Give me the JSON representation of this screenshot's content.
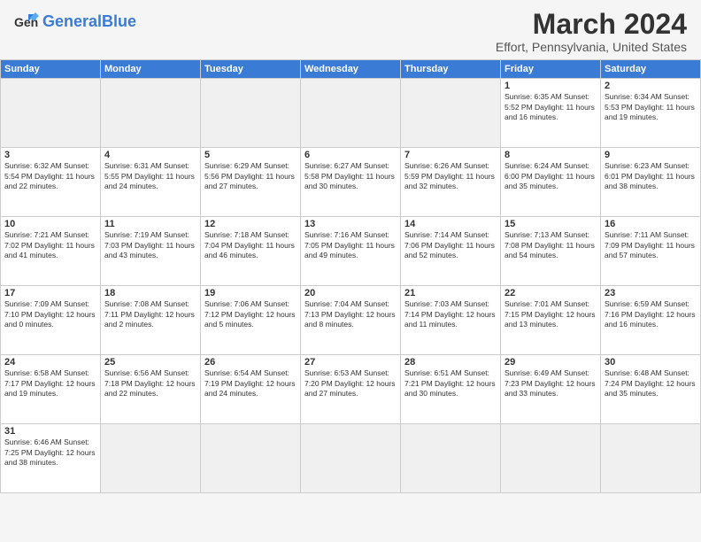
{
  "header": {
    "logo_general": "General",
    "logo_blue": "Blue",
    "month_year": "March 2024",
    "location": "Effort, Pennsylvania, United States"
  },
  "weekdays": [
    "Sunday",
    "Monday",
    "Tuesday",
    "Wednesday",
    "Thursday",
    "Friday",
    "Saturday"
  ],
  "weeks": [
    [
      {
        "day": "",
        "info": "",
        "empty": true
      },
      {
        "day": "",
        "info": "",
        "empty": true
      },
      {
        "day": "",
        "info": "",
        "empty": true
      },
      {
        "day": "",
        "info": "",
        "empty": true
      },
      {
        "day": "",
        "info": "",
        "empty": true
      },
      {
        "day": "1",
        "info": "Sunrise: 6:35 AM\nSunset: 5:52 PM\nDaylight: 11 hours\nand 16 minutes."
      },
      {
        "day": "2",
        "info": "Sunrise: 6:34 AM\nSunset: 5:53 PM\nDaylight: 11 hours\nand 19 minutes."
      }
    ],
    [
      {
        "day": "3",
        "info": "Sunrise: 6:32 AM\nSunset: 5:54 PM\nDaylight: 11 hours\nand 22 minutes."
      },
      {
        "day": "4",
        "info": "Sunrise: 6:31 AM\nSunset: 5:55 PM\nDaylight: 11 hours\nand 24 minutes."
      },
      {
        "day": "5",
        "info": "Sunrise: 6:29 AM\nSunset: 5:56 PM\nDaylight: 11 hours\nand 27 minutes."
      },
      {
        "day": "6",
        "info": "Sunrise: 6:27 AM\nSunset: 5:58 PM\nDaylight: 11 hours\nand 30 minutes."
      },
      {
        "day": "7",
        "info": "Sunrise: 6:26 AM\nSunset: 5:59 PM\nDaylight: 11 hours\nand 32 minutes."
      },
      {
        "day": "8",
        "info": "Sunrise: 6:24 AM\nSunset: 6:00 PM\nDaylight: 11 hours\nand 35 minutes."
      },
      {
        "day": "9",
        "info": "Sunrise: 6:23 AM\nSunset: 6:01 PM\nDaylight: 11 hours\nand 38 minutes."
      }
    ],
    [
      {
        "day": "10",
        "info": "Sunrise: 7:21 AM\nSunset: 7:02 PM\nDaylight: 11 hours\nand 41 minutes."
      },
      {
        "day": "11",
        "info": "Sunrise: 7:19 AM\nSunset: 7:03 PM\nDaylight: 11 hours\nand 43 minutes."
      },
      {
        "day": "12",
        "info": "Sunrise: 7:18 AM\nSunset: 7:04 PM\nDaylight: 11 hours\nand 46 minutes."
      },
      {
        "day": "13",
        "info": "Sunrise: 7:16 AM\nSunset: 7:05 PM\nDaylight: 11 hours\nand 49 minutes."
      },
      {
        "day": "14",
        "info": "Sunrise: 7:14 AM\nSunset: 7:06 PM\nDaylight: 11 hours\nand 52 minutes."
      },
      {
        "day": "15",
        "info": "Sunrise: 7:13 AM\nSunset: 7:08 PM\nDaylight: 11 hours\nand 54 minutes."
      },
      {
        "day": "16",
        "info": "Sunrise: 7:11 AM\nSunset: 7:09 PM\nDaylight: 11 hours\nand 57 minutes."
      }
    ],
    [
      {
        "day": "17",
        "info": "Sunrise: 7:09 AM\nSunset: 7:10 PM\nDaylight: 12 hours\nand 0 minutes."
      },
      {
        "day": "18",
        "info": "Sunrise: 7:08 AM\nSunset: 7:11 PM\nDaylight: 12 hours\nand 2 minutes."
      },
      {
        "day": "19",
        "info": "Sunrise: 7:06 AM\nSunset: 7:12 PM\nDaylight: 12 hours\nand 5 minutes."
      },
      {
        "day": "20",
        "info": "Sunrise: 7:04 AM\nSunset: 7:13 PM\nDaylight: 12 hours\nand 8 minutes."
      },
      {
        "day": "21",
        "info": "Sunrise: 7:03 AM\nSunset: 7:14 PM\nDaylight: 12 hours\nand 11 minutes."
      },
      {
        "day": "22",
        "info": "Sunrise: 7:01 AM\nSunset: 7:15 PM\nDaylight: 12 hours\nand 13 minutes."
      },
      {
        "day": "23",
        "info": "Sunrise: 6:59 AM\nSunset: 7:16 PM\nDaylight: 12 hours\nand 16 minutes."
      }
    ],
    [
      {
        "day": "24",
        "info": "Sunrise: 6:58 AM\nSunset: 7:17 PM\nDaylight: 12 hours\nand 19 minutes."
      },
      {
        "day": "25",
        "info": "Sunrise: 6:56 AM\nSunset: 7:18 PM\nDaylight: 12 hours\nand 22 minutes."
      },
      {
        "day": "26",
        "info": "Sunrise: 6:54 AM\nSunset: 7:19 PM\nDaylight: 12 hours\nand 24 minutes."
      },
      {
        "day": "27",
        "info": "Sunrise: 6:53 AM\nSunset: 7:20 PM\nDaylight: 12 hours\nand 27 minutes."
      },
      {
        "day": "28",
        "info": "Sunrise: 6:51 AM\nSunset: 7:21 PM\nDaylight: 12 hours\nand 30 minutes."
      },
      {
        "day": "29",
        "info": "Sunrise: 6:49 AM\nSunset: 7:23 PM\nDaylight: 12 hours\nand 33 minutes."
      },
      {
        "day": "30",
        "info": "Sunrise: 6:48 AM\nSunset: 7:24 PM\nDaylight: 12 hours\nand 35 minutes."
      }
    ],
    [
      {
        "day": "31",
        "info": "Sunrise: 6:46 AM\nSunset: 7:25 PM\nDaylight: 12 hours\nand 38 minutes."
      },
      {
        "day": "",
        "info": "",
        "empty": true
      },
      {
        "day": "",
        "info": "",
        "empty": true
      },
      {
        "day": "",
        "info": "",
        "empty": true
      },
      {
        "day": "",
        "info": "",
        "empty": true
      },
      {
        "day": "",
        "info": "",
        "empty": true
      },
      {
        "day": "",
        "info": "",
        "empty": true
      }
    ]
  ]
}
